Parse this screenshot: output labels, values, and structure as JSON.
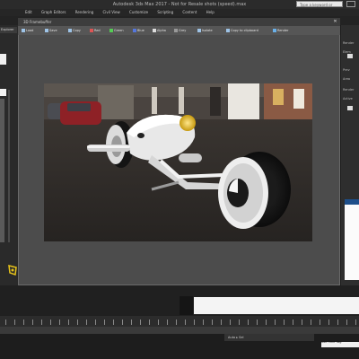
{
  "app": {
    "title": "Autodesk 3ds Max 2017 - Not for Resale   shots (speed).max",
    "search_placeholder": "Type a keyword or phrase"
  },
  "menu": [
    "Edit",
    "Graph Editors",
    "Rendering",
    "Civil View",
    "Customize",
    "Scripting",
    "Content",
    "Help"
  ],
  "frame_buffer": {
    "title": "3D Framebuffer",
    "toolbar": [
      "Load",
      "Save",
      "Copy",
      "Red",
      "Green",
      "Blue",
      "Alpha",
      "Grey",
      "Isolate",
      "Copy to clipboard",
      "Render"
    ]
  },
  "left_panel": {
    "tab_label": "Explorer"
  },
  "right_panel": {
    "labels": [
      "Render",
      "Elem",
      "Prev",
      "Area",
      "Render",
      "Active"
    ]
  },
  "status": {
    "right_text": "Add Time Tag",
    "field_text": "Auto ▸ Sel"
  },
  "colors": {
    "accent": "#1e4f8a",
    "headlight": "#e3b21f"
  }
}
